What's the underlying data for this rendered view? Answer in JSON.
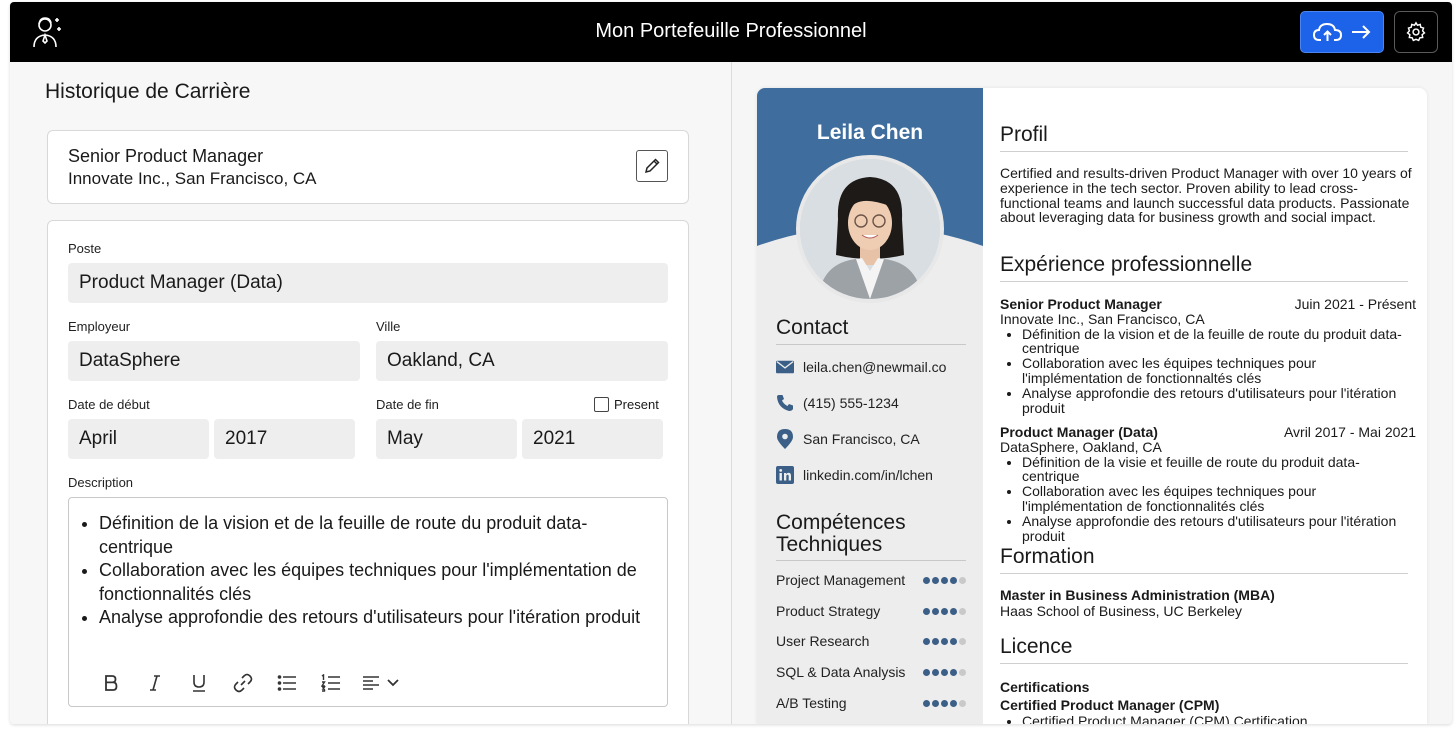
{
  "app": {
    "title": "Mon Portefeuille Professionnel"
  },
  "left": {
    "section_title": "Historique de Carrière",
    "summary_card": {
      "role": "Senior Product Manager",
      "company": "Innovate Inc., San Francisco, CA"
    },
    "form": {
      "poste_label": "Poste",
      "poste_value": "Product Manager (Data)",
      "employeur_label": "Employeur",
      "employeur_value": "DataSphere",
      "ville_label": "Ville",
      "ville_value": "Oakland, CA",
      "debut_label": "Date de début",
      "debut_month": "April",
      "debut_year": "2017",
      "fin_label": "Date de fin",
      "fin_month": "May",
      "fin_year": "2021",
      "present_label": "Present",
      "description_label": "Description",
      "description_items": [
        "Définition de la vision et de la feuille de route du produit data-centrique",
        "Collaboration avec les équipes techniques pour l'implémentation de fonctionnalités clés",
        "Analyse approfondie des retours d'utilisateurs pour l'itération produit"
      ]
    }
  },
  "resume": {
    "name": "Leila Chen",
    "contact_title": "Contact",
    "contact": {
      "email": "leila.chen@newmail.co",
      "phone": "(415) 555-1234",
      "location": "San Francisco, CA",
      "linkedin": "linkedin.com/in/lchen"
    },
    "skills_title_1": "Compétences",
    "skills_title_2": "Techniques",
    "skills": [
      {
        "name": "Project Management",
        "level": 4
      },
      {
        "name": "Product Strategy",
        "level": 4
      },
      {
        "name": "User Research",
        "level": 4
      },
      {
        "name": "SQL & Data Analysis",
        "level": 4
      },
      {
        "name": "A/B Testing",
        "level": 4
      }
    ],
    "skills_max": 5,
    "profile_title": "Profil",
    "profile_text": "Certified and results-driven Product Manager with over 10 years of experience in the tech sector. Proven ability to lead cross-functional teams and launch successful data products. Passionate about leveraging data for business growth and social impact.",
    "experience_title": "Expérience professionnelle",
    "jobs": [
      {
        "title": "Senior Product Manager",
        "dates": "Juin 2021 - Présent",
        "company": "Innovate Inc., San Francisco, CA",
        "bullets": [
          "Définition de la vision et de la feuille de route du produit data-centrique",
          "Collaboration avec les équipes techniques pour l'implémentation de fonctionnaltés clés",
          "Analyse approfondie des retours d'utilisateurs pour l'itération produit"
        ]
      },
      {
        "title": "Product Manager (Data)",
        "dates": "Avril 2017 - Mai 2021",
        "company": "DataSphere, Oakland, CA",
        "bullets": [
          "Définition de la visie et feuille de route du produit data-centrique",
          "Collaboration avec les équipes techniques pour l'implémentation de fonctionnalités clés",
          "Analyse approfondie des retours d'utilisateurs pour l'itération produit"
        ]
      }
    ],
    "education_title": "Formation",
    "degree": "Master in Business Administration (MBA)",
    "school": "Haas School of Business, UC Berkeley",
    "licence_title": "Licence",
    "certifications_label": "Certifications",
    "cert_name": "Certified Product Manager (CPM)",
    "cert_item": "Certified Product Manager (CPM) Certification"
  },
  "colors": {
    "accent": "#1d63ea",
    "resume_header": "#3f6e9e",
    "skill_dot": "#3b5f86"
  }
}
